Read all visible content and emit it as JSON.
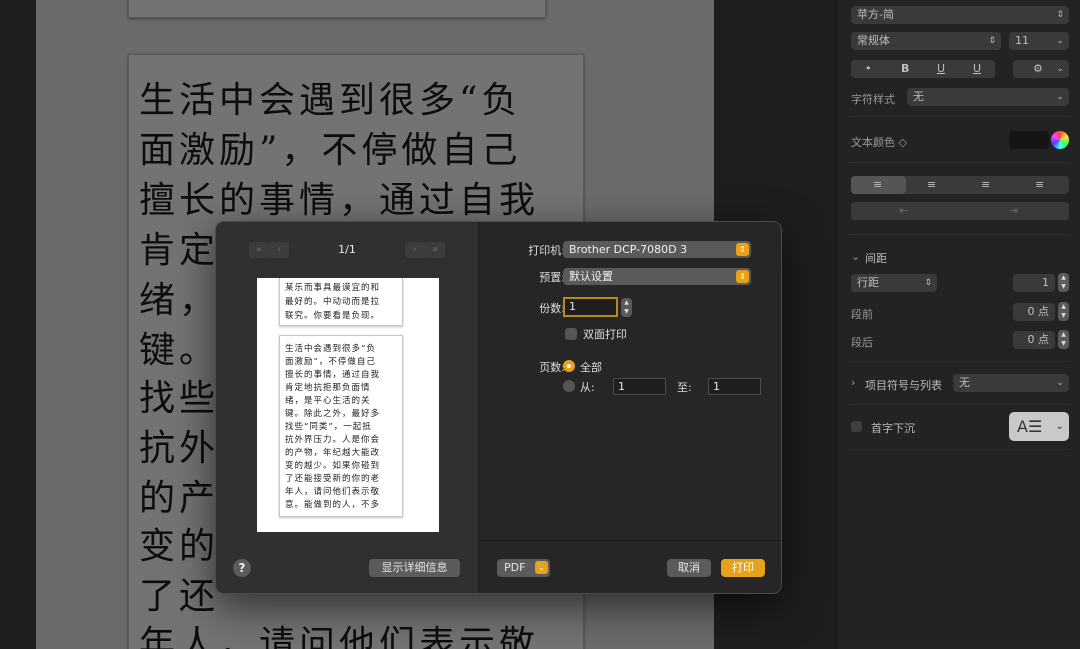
{
  "document": {
    "page_main_lines": [
      "生活中会遇到很多“负",
      "面激励”，不停做自己",
      "擅长的事情，通过自我",
      "肯定",
      "绪，",
      "键。",
      "找些",
      "抗外",
      "的产",
      "变的",
      "了还",
      "年人，请问他们表示敬"
    ]
  },
  "inspector": {
    "font_family": "苹方-简",
    "font_style": "常规体",
    "font_size": "11",
    "style_buttons": [
      "•",
      "B",
      "U",
      "U"
    ],
    "char_style_label": "字符样式",
    "char_style_value": "无",
    "text_color_label": "文本颜色 ◇",
    "spacing_label": "间距",
    "line_spacing_value": "行距",
    "line_spacing_num": "1",
    "before_label": "段前",
    "before_value": "0 点",
    "after_label": "段后",
    "after_value": "0 点",
    "bullets_label": "项目符号与列表",
    "bullets_value": "无",
    "drop_cap_label": "首字下沉"
  },
  "print_dialog": {
    "page_count": "1/1",
    "preview_top_lines": [
      "某乐而事具最谟宜的和",
      "最好的。中动动而是拉",
      "联究。你要看是负现。"
    ],
    "preview_main_lines": [
      "生活中会遇到很多“负",
      "面激励”，不停做自己",
      "擅长的事情，通过自我",
      "肯定地抗拒那负面情",
      "绪，是平心生活的关",
      "键。除此之外，最好多",
      "找些“同类”，一起抵",
      "抗外界压力。人是你会",
      "的产物，年纪越大能改",
      "变的越少。如果你碰到",
      "了还能接受新的你的老",
      "年人，请问他们表示敬",
      "意。能做到的人，不多"
    ],
    "show_details": "显示详细信息",
    "help": "?",
    "printer_label": "打印机:",
    "printer_value": "Brother DCP-7080D 3",
    "preset_label": "预置:",
    "preset_value": "默认设置",
    "copies_label": "份数:",
    "copies_value": "1",
    "duplex_label": "双面打印",
    "pages_label": "页数:",
    "pages_all": "全部",
    "pages_from": "从:",
    "pages_from_value": "1",
    "pages_to": "至:",
    "pages_to_value": "1",
    "pdf_label": "PDF",
    "cancel_label": "取消",
    "print_label": "打印"
  },
  "colors": {
    "accent": "#e7a21a",
    "dialog_bg": "#2e2e2e",
    "inspector_bg": "#232323"
  }
}
